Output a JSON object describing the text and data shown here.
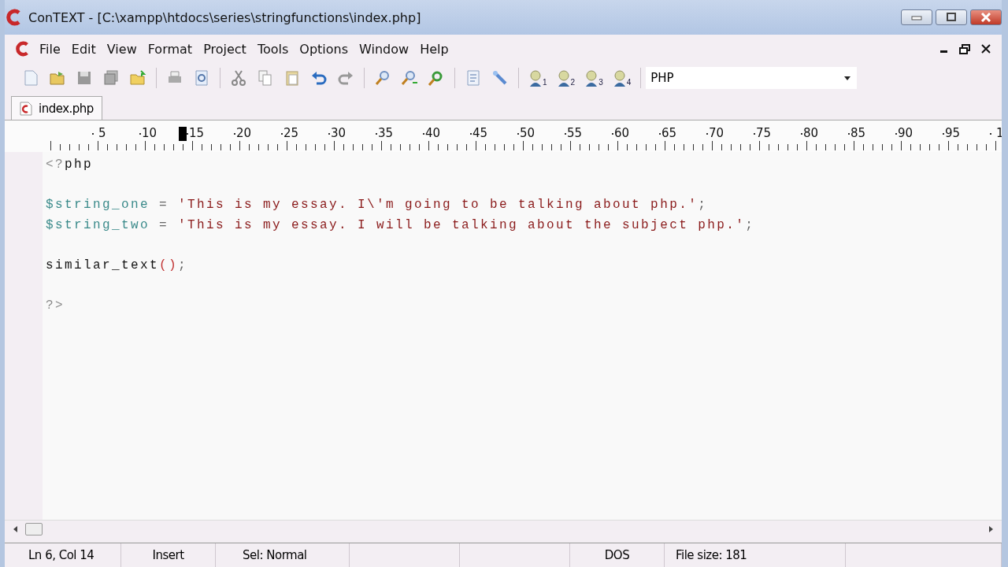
{
  "window": {
    "title": "ConTEXT - [C:\\xampp\\htdocs\\series\\stringfunctions\\index.php]"
  },
  "menu": [
    "File",
    "Edit",
    "View",
    "Format",
    "Project",
    "Tools",
    "Options",
    "Window",
    "Help"
  ],
  "toolbar": {
    "bookmarks": [
      "1",
      "2",
      "3",
      "4"
    ],
    "highlighter": "PHP"
  },
  "tabs": [
    {
      "label": "index.php",
      "selected": true
    }
  ],
  "ruler": {
    "labels": [
      "5",
      "10",
      "15",
      "20",
      "25",
      "30",
      "35",
      "40",
      "45",
      "50",
      "55",
      "60",
      "65",
      "70",
      "75",
      "80",
      "85",
      "90",
      "95",
      "1"
    ]
  },
  "code": [
    {
      "gap_before": false,
      "tokens": [
        {
          "kind": "tag",
          "text": "<?"
        },
        {
          "kind": "plain",
          "text": "php"
        }
      ]
    },
    {
      "gap_before": true,
      "tokens": [
        {
          "kind": "var",
          "text": "$string_one"
        },
        {
          "kind": "op",
          "text": " = "
        },
        {
          "kind": "str",
          "text": "'This is my essay. I\\'m going to be talking about php.'"
        },
        {
          "kind": "op",
          "text": ";"
        }
      ]
    },
    {
      "gap_before": false,
      "tokens": [
        {
          "kind": "var",
          "text": "$string_two"
        },
        {
          "kind": "op",
          "text": " = "
        },
        {
          "kind": "str",
          "text": "'This is my essay. I will be talking about the subject php.'"
        },
        {
          "kind": "op",
          "text": ";"
        }
      ]
    },
    {
      "gap_before": true,
      "tokens": [
        {
          "kind": "plain",
          "text": "similar_text"
        },
        {
          "kind": "paren",
          "text": "()"
        },
        {
          "kind": "op",
          "text": ";"
        }
      ]
    },
    {
      "gap_before": true,
      "tokens": [
        {
          "kind": "tag",
          "text": "?>"
        }
      ]
    }
  ],
  "status_bar": {
    "position": "Ln 6, Col 14",
    "mode": "Insert",
    "selection": "Sel: Normal",
    "line_endings": "DOS",
    "file_size": "File size: 181"
  }
}
